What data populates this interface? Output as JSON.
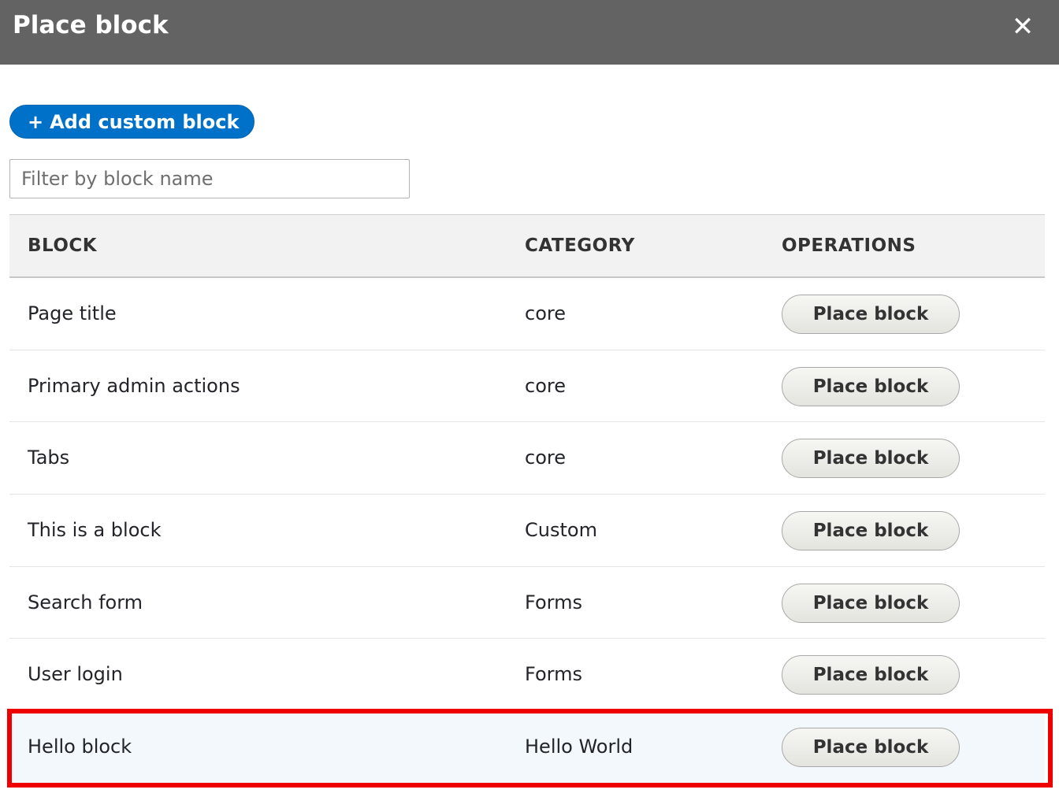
{
  "dialog": {
    "title": "Place block",
    "close_icon": "close-icon"
  },
  "toolbar": {
    "add_label": "Add custom block",
    "add_icon": "+"
  },
  "filter": {
    "placeholder": "Filter by block name",
    "value": ""
  },
  "table": {
    "headers": [
      "BLOCK",
      "CATEGORY",
      "OPERATIONS"
    ],
    "rows": [
      {
        "block": "Page title",
        "category": "core",
        "operation": "Place block"
      },
      {
        "block": "Primary admin actions",
        "category": "core",
        "operation": "Place block"
      },
      {
        "block": "Tabs",
        "category": "core",
        "operation": "Place block"
      },
      {
        "block": "This is a block",
        "category": "Custom",
        "operation": "Place block"
      },
      {
        "block": "Search form",
        "category": "Forms",
        "operation": "Place block"
      },
      {
        "block": "User login",
        "category": "Forms",
        "operation": "Place block"
      },
      {
        "block": "Hello block",
        "category": "Hello World",
        "operation": "Place block",
        "highlighted": true
      }
    ]
  },
  "colors": {
    "titlebar": "#636363",
    "primary_button": "#0071c8",
    "highlight_outline": "#ee0000",
    "highlight_row": "#f2f8fc"
  }
}
